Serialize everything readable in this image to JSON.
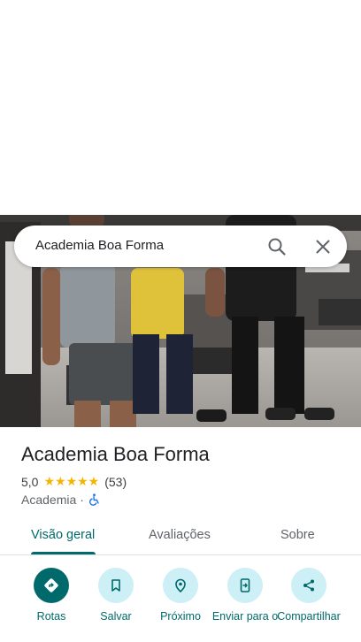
{
  "search": {
    "query": "Academia Boa Forma"
  },
  "place": {
    "title": "Academia Boa Forma",
    "rating": "5,0",
    "stars": "★★★★★",
    "review_count": "(53)",
    "category": "Academia",
    "separator": "·"
  },
  "tabs": [
    {
      "label": "Visão geral",
      "active": true
    },
    {
      "label": "Avaliações",
      "active": false
    },
    {
      "label": "Sobre",
      "active": false
    }
  ],
  "actions": [
    {
      "label": "Rotas",
      "icon": "directions-icon"
    },
    {
      "label": "Salvar",
      "icon": "bookmark-icon"
    },
    {
      "label": "Próximo",
      "icon": "nearby-icon"
    },
    {
      "label": "Enviar para o",
      "icon": "send-to-phone-icon"
    },
    {
      "label": "Compartilhar",
      "icon": "share-icon"
    }
  ],
  "colors": {
    "accent": "#00696b",
    "action_bg": "#cdeff6",
    "star": "#f5b400",
    "wheelchair": "#1a73e8"
  }
}
